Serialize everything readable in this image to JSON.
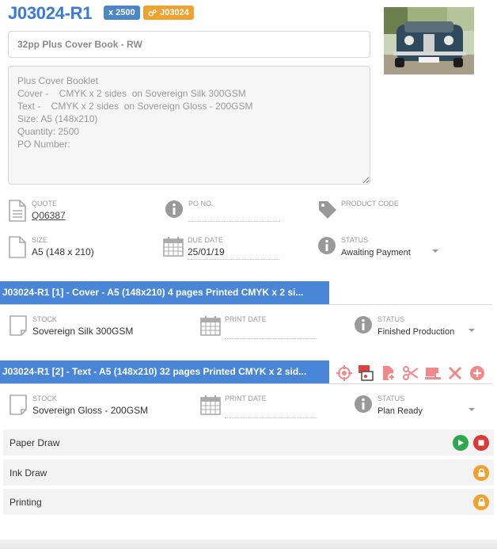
{
  "job": {
    "title": "J03024-R1",
    "qty_badge": "x 2500",
    "job_badge": "J03024"
  },
  "product": {
    "name": "32pp Plus Cover Book - RW",
    "description": "Plus Cover Booklet\nCover -    CMYK x 2 sides  on Sovereign Silk 300GSM\nText -    CMYK x 2 sides  on Sovereign Gloss - 200GSM\nSize: A5 (148x210)\nQuantity: 2500\nPO Number:"
  },
  "fields": {
    "quote_label": "QUOTE",
    "quote_value": "Q06387",
    "po_label": "PO NO.",
    "product_code_label": "PRODUCT CODE",
    "size_label": "SIZE",
    "size_value": "A5 (148 x 210)",
    "due_label": "DUE DATE",
    "due_value": "25/01/19",
    "status_label": "STATUS",
    "status_value": "Awaiting Payment"
  },
  "parts": [
    {
      "title": "J03024-R1 [1] - Cover - A5 (148x210) 4 pages Printed CMYK x 2 si...",
      "stock_label": "STOCK",
      "stock_value": "Sovereign Silk 300GSM",
      "print_date_label": "PRINT DATE",
      "status_label": "STATUS",
      "status_value": "Finished Production"
    },
    {
      "title": "J03024-R1 [2] - Text - A5 (148x210) 32 pages Printed CMYK x 2 sid...",
      "stock_label": "STOCK",
      "stock_value": "Sovereign Gloss - 200GSM",
      "print_date_label": "PRINT DATE",
      "status_label": "STATUS",
      "status_value": "Plan Ready"
    }
  ],
  "tasks": [
    {
      "name": "Paper Draw"
    },
    {
      "name": "Ink Draw"
    },
    {
      "name": "Printing"
    }
  ],
  "colors": {
    "accent": "#3a7bd5",
    "part_bar": "#4a86d8",
    "badge_orange": "#f0a22e",
    "tool_red": "#f08a8a",
    "play_green": "#2ea84f",
    "stop_red": "#d93a3a",
    "lock_orange": "#f0a22e"
  }
}
